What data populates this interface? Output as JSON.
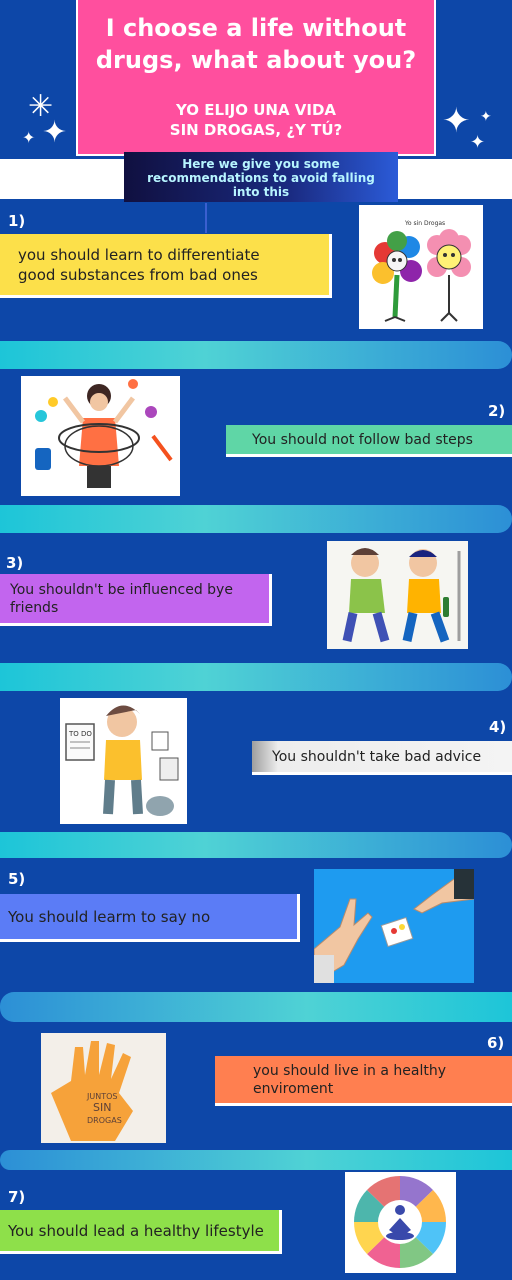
{
  "header": {
    "title": "I choose a life without drugs, what about you?",
    "subtitle_line1": "YO ELIJO UNA VIDA",
    "subtitle_line2": "SIN DROGAS, ¿Y TÚ?"
  },
  "intro": {
    "line1": "Here we give you some",
    "line2": "recommendations to avoid falling",
    "line3": "into this"
  },
  "tips": [
    {
      "number": "1)",
      "line1": "you should learn to differentiate",
      "line2": "good substances from bad ones"
    },
    {
      "number": "2)",
      "line1": "You should not follow bad steps"
    },
    {
      "number": "3)",
      "line1": "You shouldn't be influenced bye",
      "line2": "friends"
    },
    {
      "number": "4)",
      "line1": "You shouldn't take bad advice"
    },
    {
      "number": "5)",
      "line1": "You should learm to say no"
    },
    {
      "number": "6)",
      "line1": "you should live in a healthy",
      "line2": "enviroment"
    },
    {
      "number": "7)",
      "line1": "You should lead a healthy lifestyle"
    }
  ],
  "illustrations": {
    "flowers_label": "Yo sin Drogas",
    "hand_label1": "JUNTOS",
    "hand_label2": "SIN",
    "hand_label3": "DROGAS",
    "todo_label": "TO DO"
  },
  "colors": {
    "background": "#0d47a8",
    "title_box": "#ff4f9e",
    "tip1": "#fce04a",
    "tip2": "#5fd6a6",
    "tip3": "#c265ee",
    "tip4": "#d8d8d8",
    "tip5": "#5b7cf6",
    "tip6": "#ff7f50",
    "tip7": "#8ee04a"
  }
}
